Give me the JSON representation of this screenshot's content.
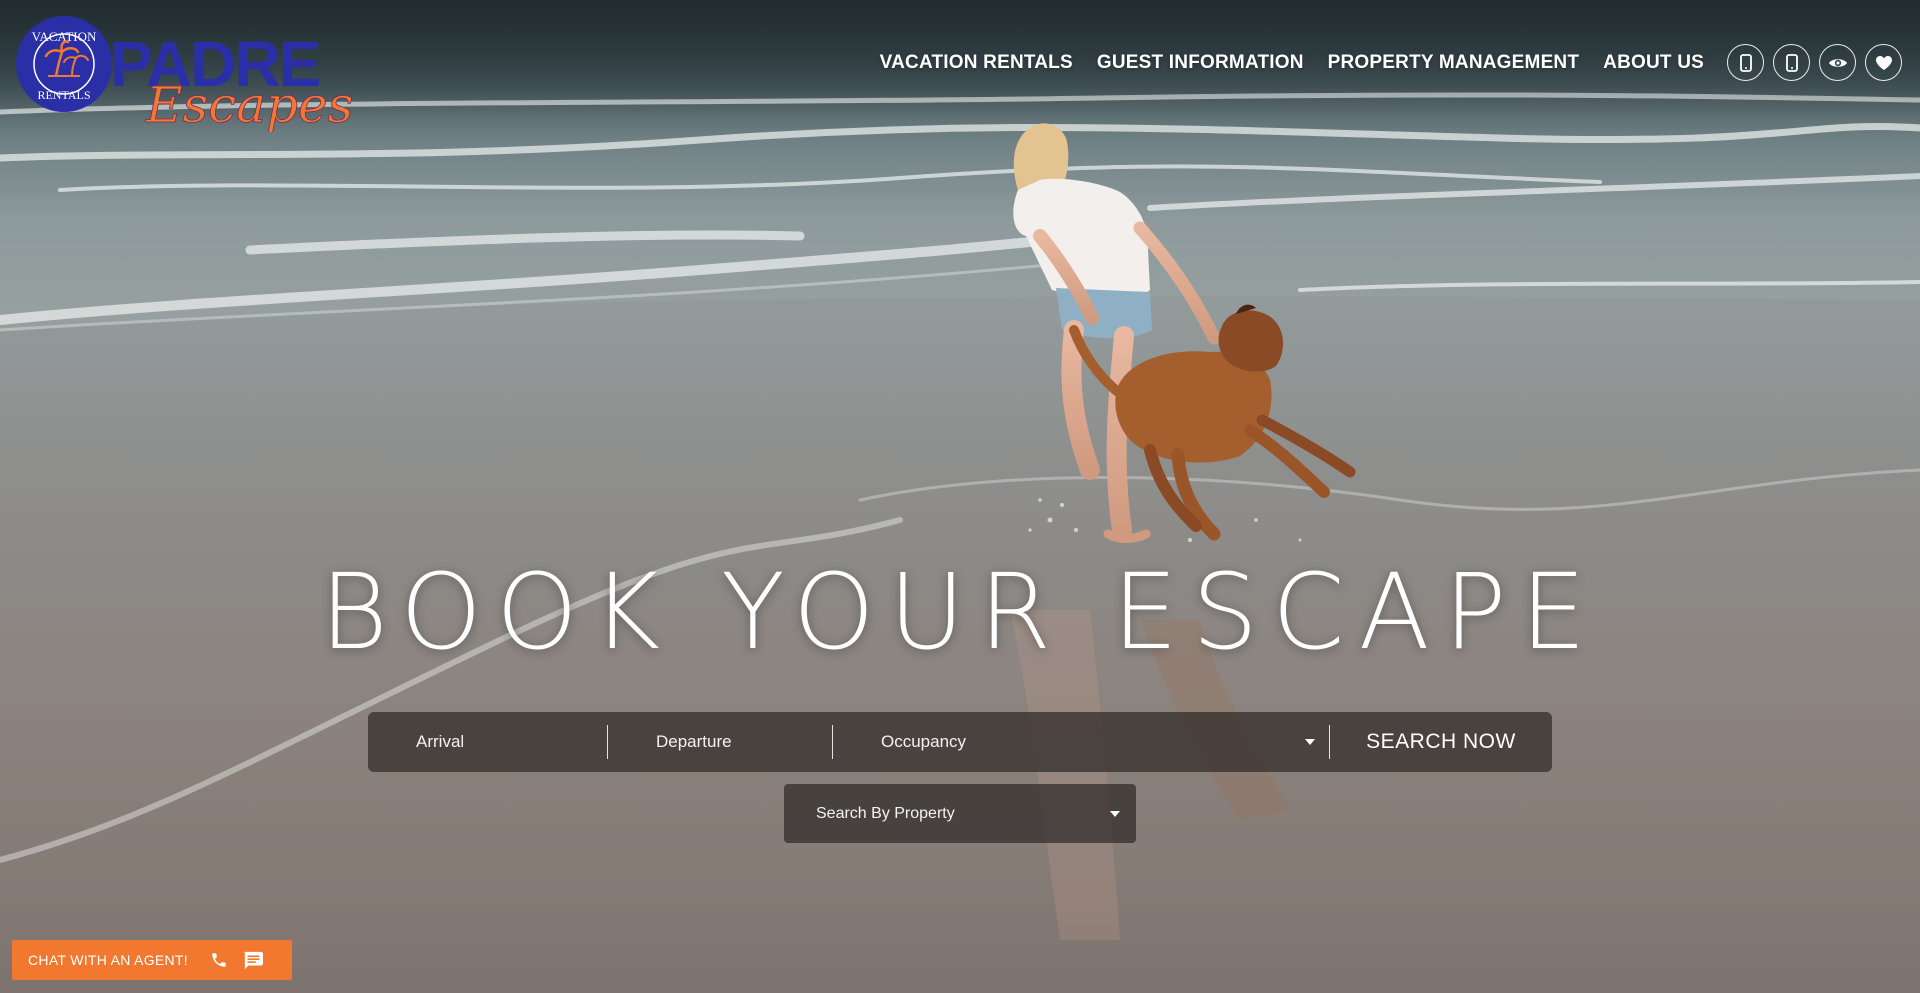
{
  "header": {
    "logo": {
      "badge_top": "VACATION",
      "badge_bottom": "RENTALS",
      "brand_main": "PADRE",
      "brand_script": "Escapes"
    },
    "nav": [
      {
        "label": "VACATION RENTALS"
      },
      {
        "label": "GUEST INFORMATION"
      },
      {
        "label": "PROPERTY MANAGEMENT"
      },
      {
        "label": "ABOUT US"
      }
    ],
    "icons": [
      "phone-icon",
      "mobile-icon",
      "eye-icon",
      "heart-icon"
    ]
  },
  "hero": {
    "headline": "BOOK YOUR ESCAPE"
  },
  "search": {
    "arrival_placeholder": "Arrival",
    "departure_placeholder": "Departure",
    "occupancy_placeholder": "Occupancy",
    "button_label": "SEARCH NOW",
    "property_placeholder": "Search By Property"
  },
  "chat": {
    "label": "CHAT WITH AN AGENT!",
    "icons": [
      "phone-icon",
      "message-icon"
    ]
  },
  "colors": {
    "brand_blue": "#2a2fa8",
    "brand_orange": "#f1782e",
    "search_bg": "#3a3432"
  }
}
